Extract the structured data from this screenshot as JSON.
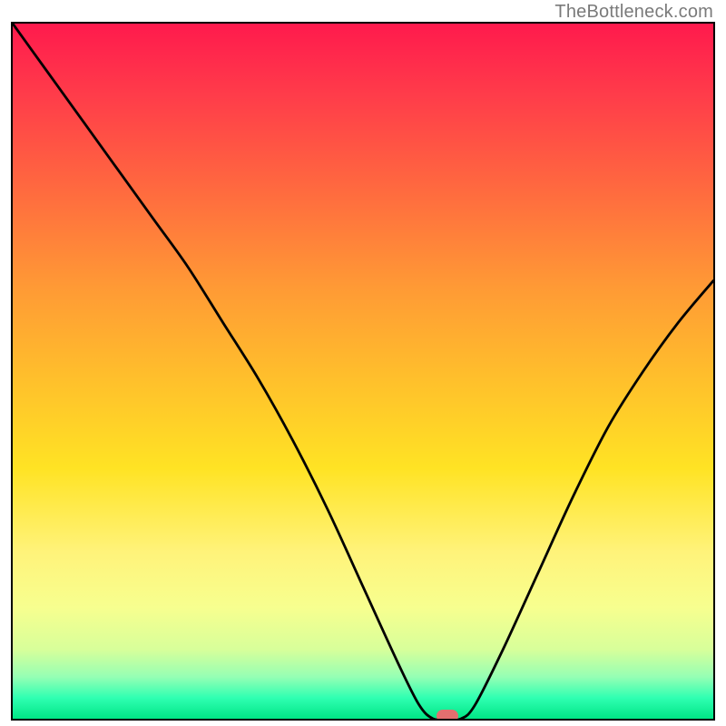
{
  "watermark": "TheBottleneck.com",
  "chart_data": {
    "type": "line",
    "x": [
      0.0,
      0.05,
      0.1,
      0.15,
      0.2,
      0.25,
      0.3,
      0.35,
      0.4,
      0.45,
      0.5,
      0.55,
      0.58,
      0.6,
      0.62,
      0.64,
      0.66,
      0.7,
      0.75,
      0.8,
      0.85,
      0.9,
      0.95,
      1.0
    ],
    "values": [
      1.0,
      0.93,
      0.86,
      0.79,
      0.72,
      0.65,
      0.57,
      0.49,
      0.4,
      0.3,
      0.19,
      0.08,
      0.02,
      0.0,
      0.0,
      0.0,
      0.02,
      0.1,
      0.21,
      0.32,
      0.42,
      0.5,
      0.57,
      0.63
    ],
    "xlabel": "",
    "ylabel": "",
    "xlim": [
      0,
      1
    ],
    "ylim": [
      0,
      1
    ],
    "marker": {
      "x": 0.62,
      "y": 0.0
    },
    "background_gradient": {
      "top": "#ff1a4d",
      "bottom": "#00e685"
    }
  }
}
